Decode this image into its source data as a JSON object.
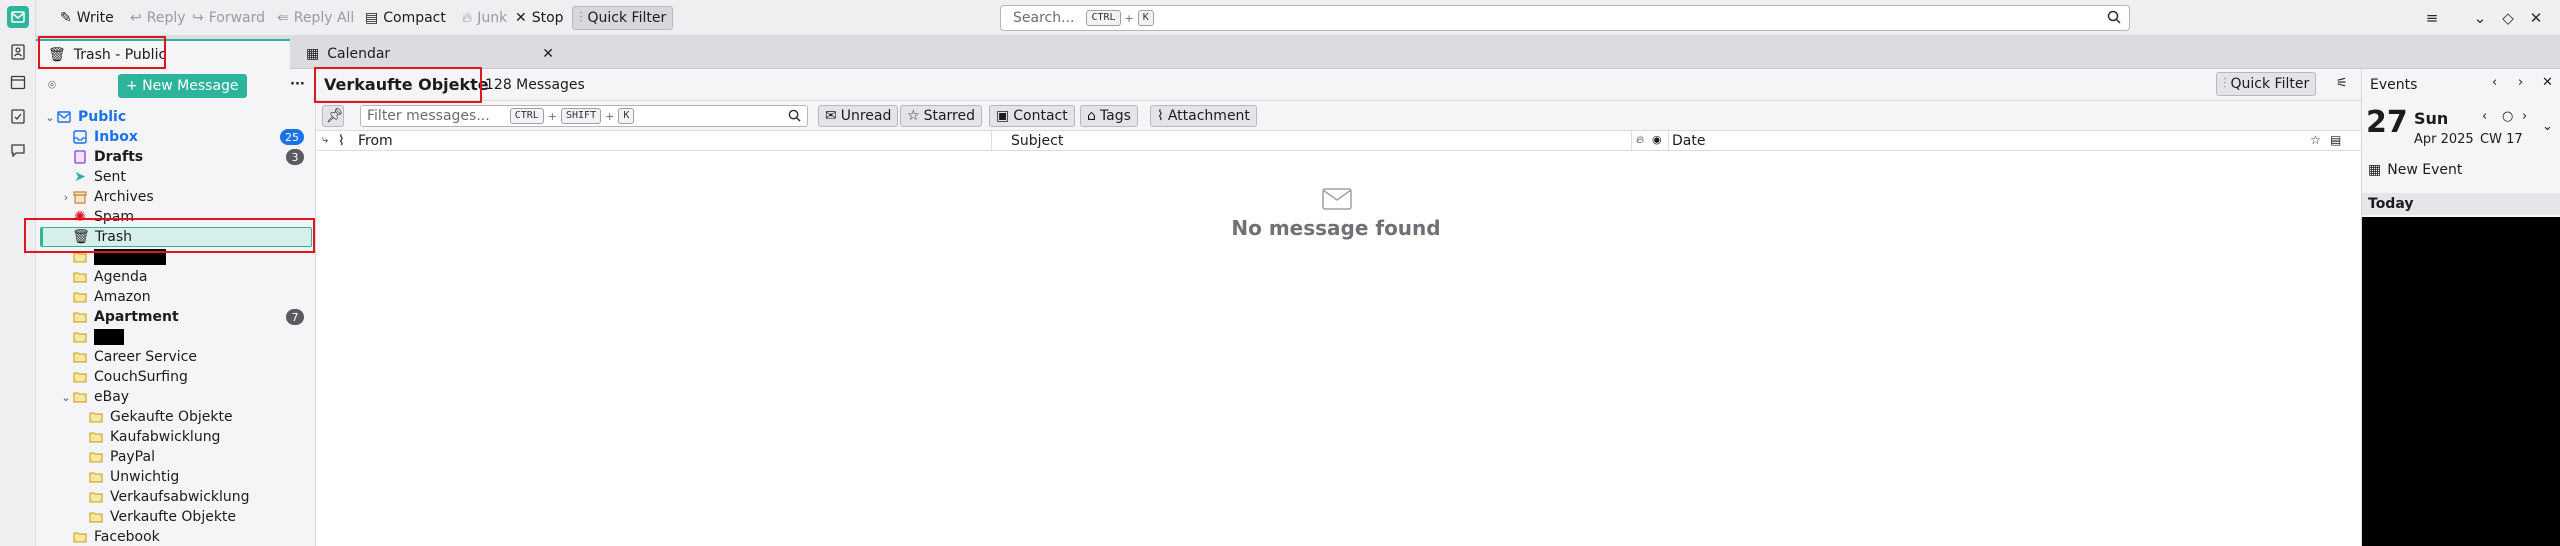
{
  "toolbar": {
    "write": "Write",
    "reply": "Reply",
    "forward": "Forward",
    "reply_all": "Reply All",
    "compact": "Compact",
    "junk": "Junk",
    "stop": "Stop",
    "quick_filter": "Quick Filter",
    "search_placeholder": "Search...",
    "search_kbd1": "CTRL",
    "search_plus": "+",
    "search_kbd2": "K"
  },
  "tabs": [
    {
      "label": "Trash - Public",
      "selected": true
    },
    {
      "label": "Calendar",
      "selected": false
    }
  ],
  "folderpane": {
    "new_message": "+ New Message",
    "more": "···",
    "account": "Public",
    "folders": [
      {
        "label": "Inbox",
        "badge": "25",
        "icon": "inbox-icon"
      },
      {
        "label": "Drafts",
        "badge": "3",
        "icon": "drafts-icon"
      },
      {
        "label": "Sent",
        "icon": "sent-icon"
      },
      {
        "label": "Archives",
        "icon": "archive-icon"
      },
      {
        "label": "Spam",
        "icon": "spam-icon"
      },
      {
        "label": "Trash",
        "icon": "trash-icon"
      },
      {
        "label": "Agenda"
      },
      {
        "label": "Amazon"
      },
      {
        "label": "Apartment",
        "badge": "7"
      },
      {
        "label": "Career Service"
      },
      {
        "label": "CouchSurfing"
      },
      {
        "label": "eBay"
      },
      {
        "label": "Gekaufte Objekte"
      },
      {
        "label": "Kaufabwicklung"
      },
      {
        "label": "PayPal"
      },
      {
        "label": "Unwichtig"
      },
      {
        "label": "Verkaufsabwicklung"
      },
      {
        "label": "Verkaufte Objekte"
      },
      {
        "label": "Facebook"
      }
    ]
  },
  "threadpane": {
    "folder_title": "Verkaufte Objekte",
    "message_count": "128 Messages",
    "quick_filter": "Quick Filter",
    "filter_placeholder": "Filter messages...",
    "filter_kbd": [
      "CTRL",
      "SHIFT",
      "K"
    ],
    "filter_plus": "+",
    "filter_buttons": {
      "unread": "Unread",
      "starred": "Starred",
      "contact": "Contact",
      "tags": "Tags",
      "attachment": "Attachment"
    },
    "columns": {
      "from": "From",
      "subject": "Subject",
      "date": "Date"
    },
    "empty_message": "No message found"
  },
  "events": {
    "title": "Events",
    "day": "27",
    "weekday": "Sun",
    "month_year": "Apr 2025",
    "cw": "CW 17",
    "new_event": "New Event",
    "today": "Today"
  },
  "colors": {
    "accent": "#2db49b",
    "badge_blue": "#1a73e8",
    "badge_gray": "#5a5a60",
    "highlight_red": "#e0161f",
    "folder_blue": "#1a73e8"
  }
}
